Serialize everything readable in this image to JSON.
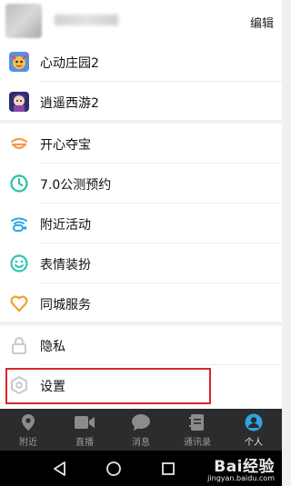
{
  "header": {
    "edit_label": "编辑"
  },
  "games": [
    {
      "label": "心动庄园2",
      "icon": "game-heart-farm-icon"
    },
    {
      "label": "逍遥西游2",
      "icon": "game-xiaoyao-icon"
    }
  ],
  "services": [
    {
      "label": "开心夺宝",
      "icon": "treasure-icon",
      "color": "#f39a45"
    },
    {
      "label": "7.0公测预约",
      "icon": "clock-icon",
      "color": "#25c2a0"
    },
    {
      "label": "附近活动",
      "icon": "nearby-activity-icon",
      "color": "#2aa6e8"
    },
    {
      "label": "表情装扮",
      "icon": "smile-icon",
      "color": "#2ec6b4"
    },
    {
      "label": "同城服务",
      "icon": "heart-icon",
      "color": "#f0a030"
    }
  ],
  "settings": [
    {
      "label": "隐私",
      "icon": "lock-icon",
      "color": "#c9c9c9"
    },
    {
      "label": "设置",
      "icon": "settings-hex-icon",
      "color": "#c9c9c9"
    }
  ],
  "tabbar": [
    {
      "label": "附近",
      "icon": "location-pin-icon",
      "active": false
    },
    {
      "label": "直播",
      "icon": "video-camera-icon",
      "active": false
    },
    {
      "label": "消息",
      "icon": "chat-bubble-icon",
      "active": false
    },
    {
      "label": "通讯录",
      "icon": "contacts-book-icon",
      "active": false
    },
    {
      "label": "个人",
      "icon": "person-icon",
      "active": true
    }
  ],
  "colors": {
    "accent": "#2ea3e5",
    "highlight": "#d8262b"
  },
  "watermark": {
    "big": "Bai经验",
    "small": "jingyan.baidu.com"
  }
}
